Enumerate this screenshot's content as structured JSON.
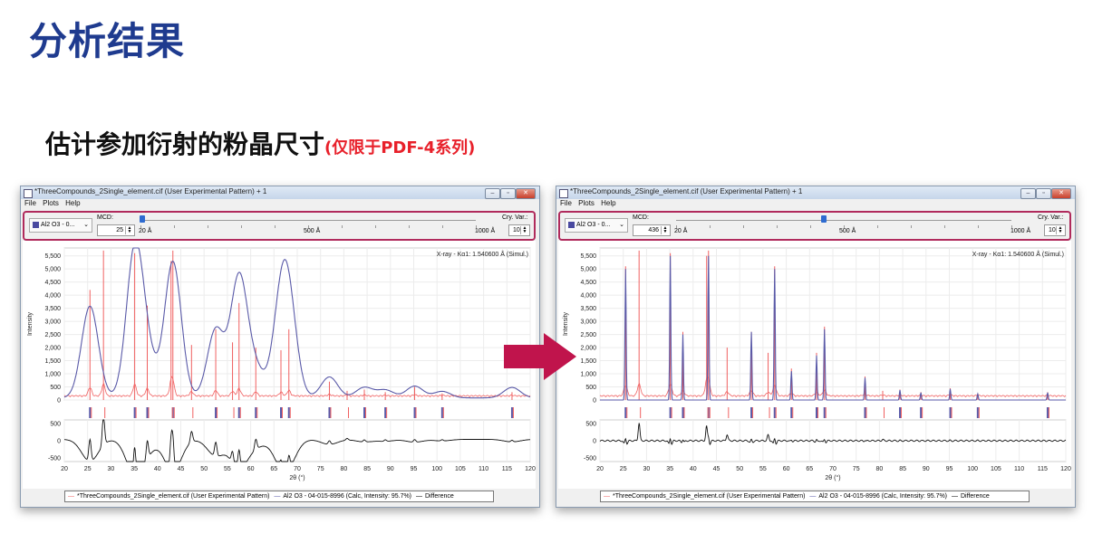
{
  "page": {
    "title": "分析结果",
    "subtitle": "估计参加衍射的粉晶尺寸",
    "subtitle_note": "(仅限于PDF-4系列)",
    "accent_color": "#1f3b8f",
    "note_color": "#e8202a"
  },
  "windows": [
    {
      "title": "*ThreeCompounds_2Single_element.cif (User Experimental Pattern) + 1",
      "menu": [
        "File",
        "Plots",
        "Help"
      ],
      "buttons": [
        "minimize",
        "maximize",
        "close"
      ],
      "component": "Al2 O3 - 0...",
      "mcd_label": "MCD:",
      "mcd_value": "25",
      "slider_labels": [
        "20 Å",
        "500 Å",
        "1000 Å"
      ],
      "slider_value_fraction": 0.005,
      "cry_var_label": "Cry. Var.:",
      "cry_var_value": "10",
      "xray_label": "X-ray - Kα1: 1.540600 Å (Simul.)",
      "legend": [
        "*ThreeCompounds_2Single_element.cif (User Experimental Pattern)",
        "Al2 O3 - 04-015-8996 (Calc, Intensity: 95.7%)",
        "Difference"
      ],
      "chart_data": {
        "type": "line",
        "ylabel": "Intensity",
        "xlabel": "2θ (°)",
        "xlim": [
          20,
          120
        ],
        "ylim": [
          0,
          5800
        ],
        "yticks": [
          "5,500",
          "5,000",
          "4,500",
          "4,000",
          "3,500",
          "3,000",
          "2,500",
          "2,000",
          "1,500",
          "1,000",
          "500",
          "0"
        ],
        "xticks": [
          "20",
          "25",
          "30",
          "35",
          "40",
          "45",
          "50",
          "55",
          "60",
          "65",
          "70",
          "75",
          "80",
          "85",
          "90",
          "95",
          "100",
          "105",
          "110",
          "115",
          "120"
        ],
        "diff_ylim": [
          -600,
          600
        ],
        "diff_yticks": [
          "500",
          "0",
          "-500"
        ],
        "series": [
          {
            "name": "*ThreeCompounds_2Single_element.cif (User Experimental Pattern)",
            "color": "#f06060",
            "peaks": [
              [
                25.5,
                4200
              ],
              [
                28.4,
                5700
              ],
              [
                35.1,
                5600
              ],
              [
                37.8,
                3600
              ],
              [
                42.9,
                5300
              ],
              [
                43.3,
                5700
              ],
              [
                47.3,
                2100
              ],
              [
                52.5,
                2700
              ],
              [
                56.1,
                2200
              ],
              [
                57.5,
                3700
              ],
              [
                61.1,
                2000
              ],
              [
                66.5,
                1900
              ],
              [
                68.2,
                2700
              ],
              [
                76.9,
                700
              ],
              [
                80.7,
                350
              ],
              [
                84.4,
                400
              ],
              [
                88.9,
                300
              ],
              [
                95.2,
                500
              ],
              [
                101.1,
                250
              ],
              [
                116.1,
                300
              ]
            ]
          },
          {
            "name": "Al2 O3 - 04-015-8996 (Calc, Intensity: 95.7%)",
            "color": "#5a5aa8",
            "peaks": [
              [
                25.5,
                3500
              ],
              [
                35.1,
                5500
              ],
              [
                37.8,
                1400
              ],
              [
                43.3,
                5200
              ],
              [
                52.5,
                2600
              ],
              [
                57.5,
                4600
              ],
              [
                61.1,
                1000
              ],
              [
                66.5,
                3000
              ],
              [
                68.2,
                2900
              ],
              [
                76.9,
                800
              ],
              [
                84.4,
                400
              ],
              [
                88.9,
                300
              ],
              [
                95.2,
                450
              ],
              [
                101.1,
                250
              ],
              [
                116.1,
                400
              ]
            ]
          },
          {
            "name": "Difference",
            "color": "#111111"
          }
        ],
        "profile_width": 1.8
      }
    },
    {
      "title": "*ThreeCompounds_2Single_element.cif (User Experimental Pattern) + 1",
      "menu": [
        "File",
        "Plots",
        "Help"
      ],
      "buttons": [
        "minimize",
        "maximize",
        "close"
      ],
      "component": "Al2 O3 - 0...",
      "mcd_label": "MCD:",
      "mcd_value": "436",
      "slider_labels": [
        "20 Å",
        "500 Å",
        "1000 Å"
      ],
      "slider_value_fraction": 0.44,
      "cry_var_label": "Cry. Var.:",
      "cry_var_value": "10",
      "xray_label": "X-ray - Kα1: 1.540600 Å (Simul.)",
      "legend": [
        "*ThreeCompounds_2Single_element.cif (User Experimental Pattern)",
        "Al2 O3 - 04-015-8996 (Calc, Intensity: 95.7%)",
        "Difference"
      ],
      "chart_data": {
        "type": "line",
        "ylabel": "Intensity",
        "xlabel": "2θ (°)",
        "xlim": [
          20,
          120
        ],
        "ylim": [
          0,
          5800
        ],
        "yticks": [
          "5,500",
          "5,000",
          "4,500",
          "4,000",
          "3,500",
          "3,000",
          "2,500",
          "2,000",
          "1,500",
          "1,000",
          "500",
          "0"
        ],
        "xticks": [
          "20",
          "25",
          "30",
          "35",
          "40",
          "45",
          "50",
          "55",
          "60",
          "65",
          "70",
          "75",
          "80",
          "85",
          "90",
          "95",
          "100",
          "105",
          "110",
          "115",
          "120"
        ],
        "diff_ylim": [
          -600,
          600
        ],
        "diff_yticks": [
          "500",
          "0",
          "-500"
        ],
        "series": [
          {
            "name": "*ThreeCompounds_2Single_element.cif (User Experimental Pattern)",
            "color": "#f06060",
            "peaks": [
              [
                25.5,
                5100
              ],
              [
                28.4,
                5700
              ],
              [
                35.1,
                5600
              ],
              [
                37.8,
                2600
              ],
              [
                42.9,
                5500
              ],
              [
                43.3,
                5700
              ],
              [
                47.3,
                2000
              ],
              [
                52.5,
                2600
              ],
              [
                56.1,
                1800
              ],
              [
                57.5,
                5100
              ],
              [
                61.1,
                1200
              ],
              [
                66.5,
                1800
              ],
              [
                68.2,
                2800
              ],
              [
                76.9,
                900
              ],
              [
                80.7,
                350
              ],
              [
                84.4,
                400
              ],
              [
                88.9,
                300
              ],
              [
                95.2,
                450
              ],
              [
                101.1,
                250
              ],
              [
                116.1,
                300
              ]
            ]
          },
          {
            "name": "Al2 O3 - 04-015-8996 (Calc, Intensity: 95.7%)",
            "color": "#5a5aa8",
            "peaks": [
              [
                25.5,
                5000
              ],
              [
                35.1,
                5500
              ],
              [
                37.8,
                2500
              ],
              [
                43.3,
                5500
              ],
              [
                52.5,
                2600
              ],
              [
                57.5,
                5000
              ],
              [
                61.1,
                1100
              ],
              [
                66.5,
                1700
              ],
              [
                68.2,
                2700
              ],
              [
                76.9,
                850
              ],
              [
                84.4,
                380
              ],
              [
                88.9,
                280
              ],
              [
                95.2,
                420
              ],
              [
                101.1,
                230
              ],
              [
                116.1,
                280
              ]
            ]
          },
          {
            "name": "Difference",
            "color": "#111111"
          }
        ],
        "profile_width": 0.12
      }
    }
  ],
  "arrow_color": "#c0144c"
}
